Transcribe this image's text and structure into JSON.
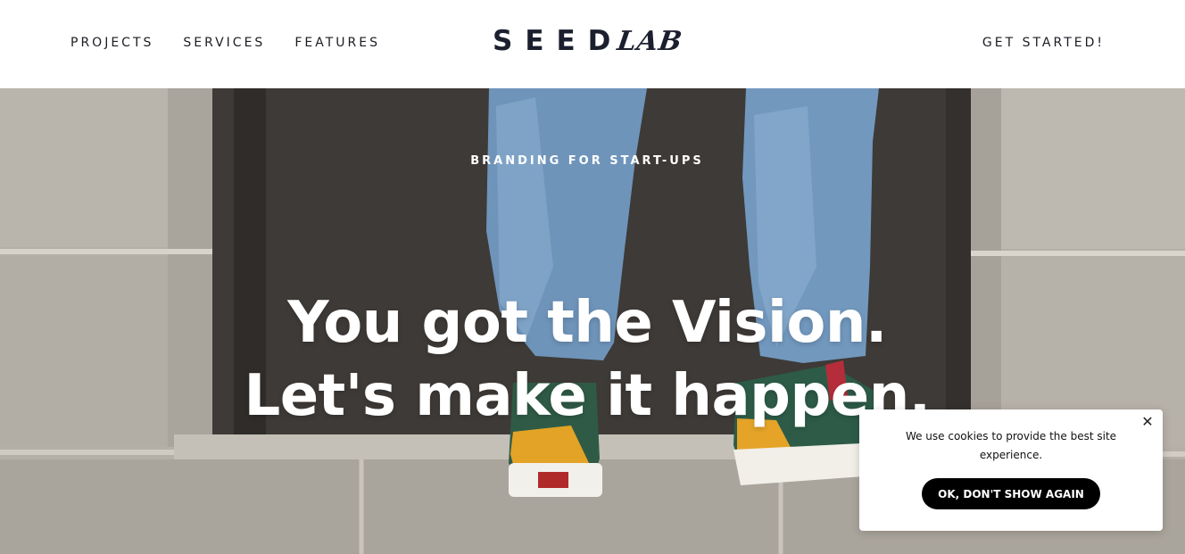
{
  "header": {
    "nav_left": [
      {
        "label": "PROJECTS"
      },
      {
        "label": "SERVICES"
      },
      {
        "label": "FEATURES"
      }
    ],
    "logo": {
      "part1": "SEED",
      "part2": "LAB"
    },
    "cta_label": "GET STARTED!"
  },
  "hero": {
    "eyebrow": "BRANDING FOR START-UPS",
    "headline_line1": "You got the Vision.",
    "headline_line2": "Let's make it happen."
  },
  "cookie_banner": {
    "message": "We use cookies to provide the best site experience.",
    "button_label": "OK, DON'T SHOW AGAIN",
    "close_icon": "close-icon"
  },
  "colors": {
    "text_dark": "#1c1c24",
    "button_bg": "#000000"
  }
}
